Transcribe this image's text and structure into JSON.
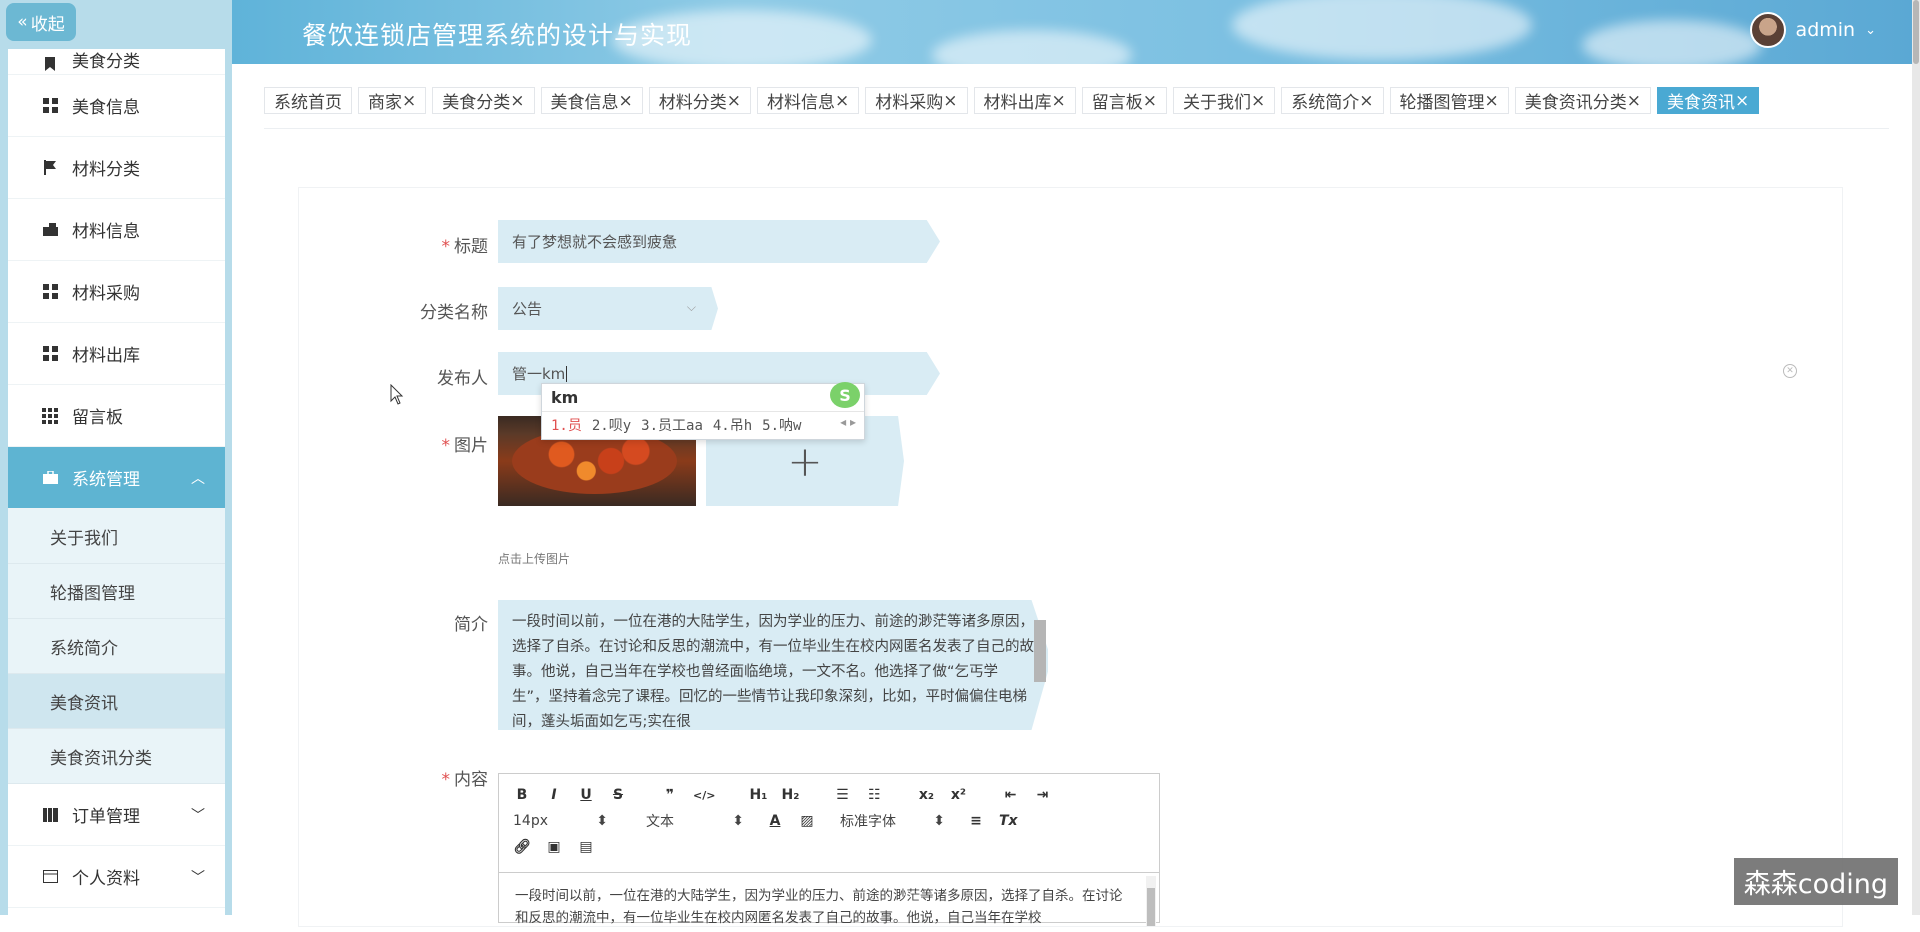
{
  "app": {
    "title": "餐饮连锁店管理系统的设计与实现"
  },
  "header": {
    "username": "admin",
    "dropdown_icon": "chevron-down-icon"
  },
  "sidebar": {
    "collapse_label": "收起",
    "items": [
      {
        "label": "美食分类",
        "icon": "bookmark-icon"
      },
      {
        "label": "美食信息",
        "icon": "grid-icon"
      },
      {
        "label": "材料分类",
        "icon": "flag-icon"
      },
      {
        "label": "材料信息",
        "icon": "inbox-icon"
      },
      {
        "label": "材料采购",
        "icon": "grid-icon"
      },
      {
        "label": "材料出库",
        "icon": "grid-icon"
      },
      {
        "label": "留言板",
        "icon": "grid9-icon"
      },
      {
        "label": "系统管理",
        "icon": "briefcase-icon",
        "expanded": true
      }
    ],
    "sub_items": [
      "关于我们",
      "轮播图管理",
      "系统简介",
      "美食资讯",
      "美食资讯分类"
    ],
    "selected_sub": "美食资讯",
    "tail_items": [
      {
        "label": "订单管理",
        "icon": "book-icon"
      },
      {
        "label": "个人资料",
        "icon": "window-icon"
      }
    ]
  },
  "tabs": [
    {
      "label": "系统首页",
      "closable": false
    },
    {
      "label": "商家",
      "closable": true
    },
    {
      "label": "美食分类",
      "closable": true
    },
    {
      "label": "美食信息",
      "closable": true
    },
    {
      "label": "材料分类",
      "closable": true
    },
    {
      "label": "材料信息",
      "closable": true
    },
    {
      "label": "材料采购",
      "closable": true
    },
    {
      "label": "材料出库",
      "closable": true
    },
    {
      "label": "留言板",
      "closable": true
    },
    {
      "label": "关于我们",
      "closable": true
    },
    {
      "label": "系统简介",
      "closable": true
    },
    {
      "label": "轮播图管理",
      "closable": true
    },
    {
      "label": "美食资讯分类",
      "closable": true
    },
    {
      "label": "美食资讯",
      "closable": true,
      "active": true
    }
  ],
  "form": {
    "title": {
      "label": "标题",
      "required": true,
      "value": "有了梦想就不会感到疲惫"
    },
    "category": {
      "label": "分类名称",
      "required": false,
      "value": "公告"
    },
    "publisher": {
      "label": "发布人",
      "required": false,
      "value": "管一km"
    },
    "image": {
      "label": "图片",
      "required": true,
      "hint": "点击上传图片",
      "add_symbol": "+"
    },
    "summary": {
      "label": "简介",
      "required": false,
      "value": "一段时间以前，一位在港的大陆学生，因为学业的压力、前途的渺茫等诸多原因，选择了自杀。在讨论和反思的潮流中，有一位毕业生在校内网匿名发表了自己的故事。他说，自己当年在学校也曾经面临绝境，一文不名。他选择了做“乞丐学生”，坚持着念完了课程。回忆的一些情节让我印象深刻，比如，平时偏偏住电梯间，蓬头垢面如乞丐;实在很"
    },
    "content": {
      "label": "内容",
      "required": true,
      "body": "一段时间以前，一位在港的大陆学生，因为学业的压力、前途的渺茫等诸多原因，选择了自杀。在讨论和反思的潮流中，有一位毕业生在校内网匿名发表了自己的故事。他说，自己当年在学校",
      "font_size": "14px",
      "block_type": "文本",
      "font_family": "标准字体"
    }
  },
  "ime": {
    "composition": "km",
    "candidates": [
      "1.员",
      "2.呗y",
      "3.员工aa",
      "4.吊h",
      "5.呐w"
    ],
    "logo": "S"
  },
  "watermark": "森森coding"
}
